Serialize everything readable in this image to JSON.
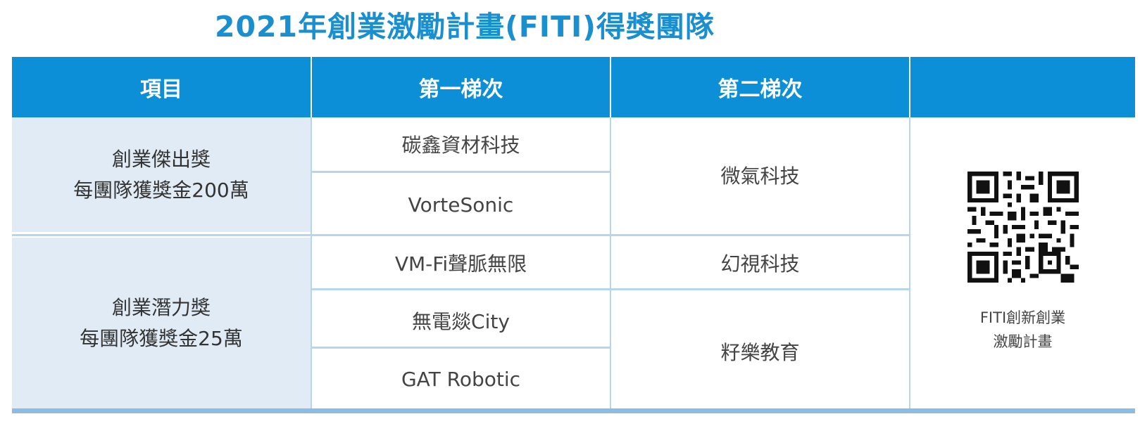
{
  "title": "2021年創業激勵計畫(FITI)得獎團隊",
  "table": {
    "headers": [
      "項目",
      "第一梯次",
      "第二梯次",
      ""
    ],
    "categories": [
      {
        "name": "創業傑出獎",
        "prize": "每團隊獲獎金200萬"
      },
      {
        "name": "創業潛力獎",
        "prize": "每團隊獲獎金25萬"
      }
    ],
    "first_batch": [
      "碳鑫資材科技",
      "VorteSonic",
      "VM-Fi聲脈無限",
      "無電燚City",
      "GAT Robotic"
    ],
    "second_batch": [
      "微氣科技",
      "幻視科技",
      "籽樂教育"
    ]
  },
  "qr": {
    "icon": "qr-code-icon",
    "caption_line1": "FITI創新創業",
    "caption_line2": "激勵計畫"
  },
  "colors": {
    "title": "#1a8fd0",
    "header_bg": "#0c8fd7",
    "category_bg": "#e1ebf6",
    "divider": "#b8d5ee"
  }
}
